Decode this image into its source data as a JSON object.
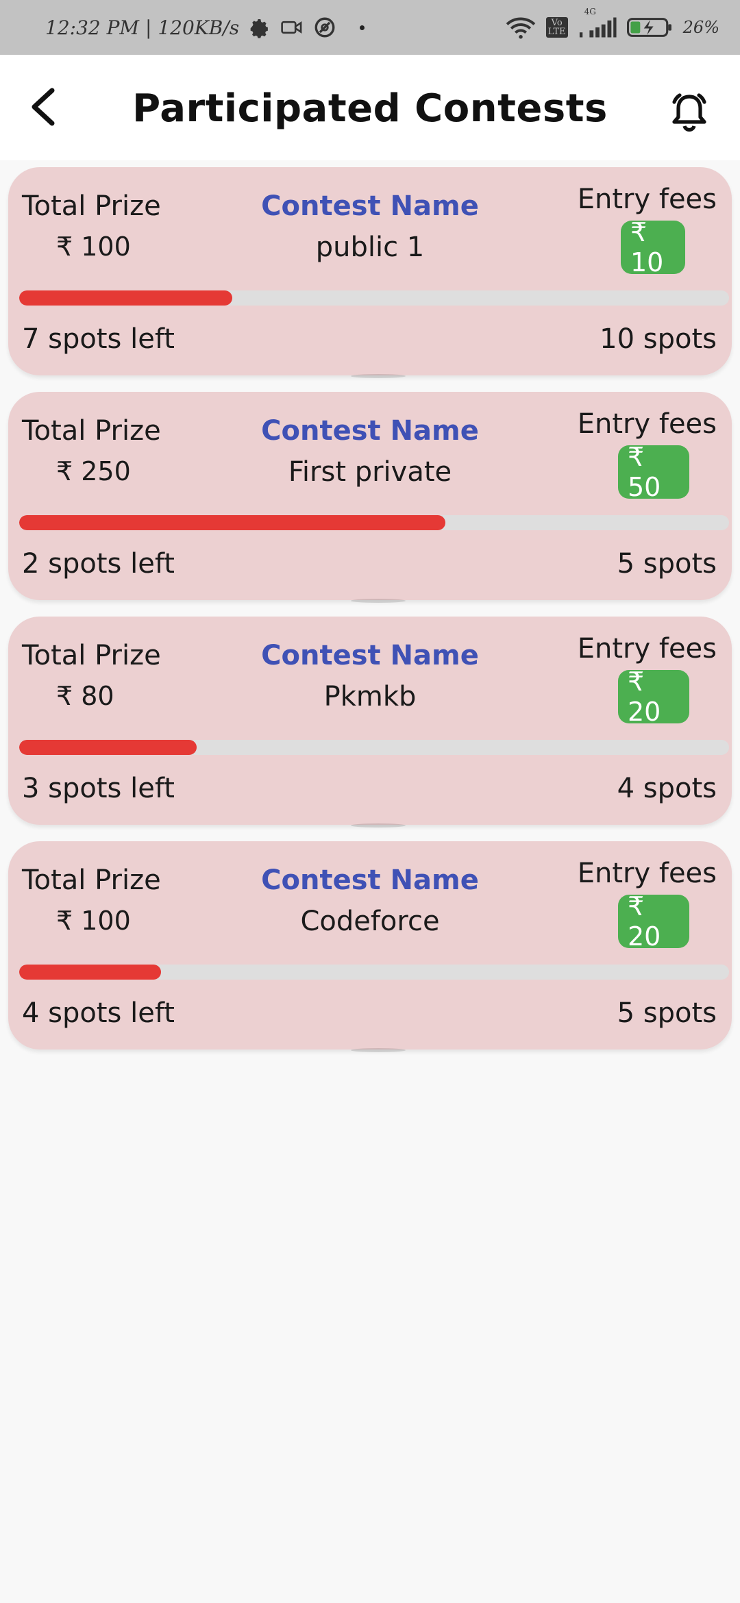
{
  "status_bar": {
    "time_text": "12:32 PM | 120KB/s",
    "network_type": "4G",
    "battery": "26%",
    "volte": "Vo LTE"
  },
  "header": {
    "title": "Participated Contests"
  },
  "contests": [
    {
      "total_prize_label": "Total Prize",
      "total_prize": "₹ 100",
      "contest_name_label": "Contest Name",
      "contest_name": "public 1",
      "entry_fees_label": "Entry fees",
      "entry_fee": "₹ 10",
      "spots_left": "7 spots left",
      "total_spots": "10 spots",
      "filled_fraction": 0.3
    },
    {
      "total_prize_label": "Total Prize",
      "total_prize": "₹ 250",
      "contest_name_label": "Contest Name",
      "contest_name": "First private",
      "entry_fees_label": "Entry fees",
      "entry_fee": "₹ 50",
      "spots_left": "2 spots left",
      "total_spots": "5 spots",
      "filled_fraction": 0.6
    },
    {
      "total_prize_label": "Total Prize",
      "total_prize": "₹ 80",
      "contest_name_label": "Contest Name",
      "contest_name": "Pkmkb",
      "entry_fees_label": "Entry fees",
      "entry_fee": "₹ 20",
      "spots_left": "3 spots left",
      "total_spots": "4 spots",
      "filled_fraction": 0.25
    },
    {
      "total_prize_label": "Total Prize",
      "total_prize": "₹ 100",
      "contest_name_label": "Contest Name",
      "contest_name": "Codeforce",
      "entry_fees_label": "Entry fees",
      "entry_fee": "₹ 20",
      "spots_left": "4 spots left",
      "total_spots": "5 spots",
      "filled_fraction": 0.2
    }
  ],
  "colors": {
    "card_bg": "#ecd0d1",
    "accent_blue": "#3f51b5",
    "fee_green": "#4caf50",
    "progress_red": "#e53935",
    "status_bar": "#c2c2c2"
  },
  "icons": {
    "back": "back-arrow-icon",
    "notifications": "bell-icon",
    "settings": "gear-icon",
    "video": "video-camera-icon",
    "vpn": "vpn-icon",
    "wifi": "wifi-icon",
    "signal": "signal-icon",
    "battery": "battery-charging-icon"
  }
}
